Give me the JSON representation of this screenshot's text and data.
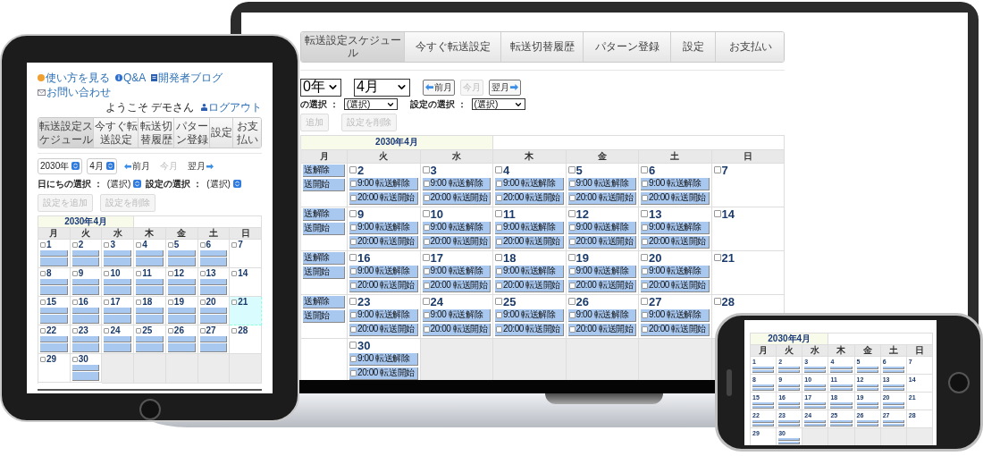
{
  "laptop": {
    "tabs": [
      {
        "label": "転送設定スケジュール",
        "selected": true
      },
      {
        "label": "今すぐ転送設定",
        "selected": false
      },
      {
        "label": "転送切替履歴",
        "selected": false
      },
      {
        "label": "パターン登録",
        "selected": false
      },
      {
        "label": "設定",
        "selected": false
      },
      {
        "label": "お支払い",
        "selected": false
      }
    ],
    "year_select": {
      "value": "0年"
    },
    "month_select": {
      "value": "4月"
    },
    "nav_buttons": [
      {
        "kind": "prev",
        "label": "前月",
        "disabled": false
      },
      {
        "kind": "plain",
        "label": "今月",
        "disabled": true
      },
      {
        "kind": "next",
        "label": "翌月",
        "disabled": false
      }
    ],
    "filters": [
      {
        "label": "の選択 ：",
        "value": "(選択)"
      },
      {
        "label": "設定の選択 ：",
        "value": "(選択)"
      }
    ],
    "actions": [
      {
        "label": "追加",
        "disabled": true
      },
      {
        "label": "設定を削除",
        "disabled": true
      }
    ],
    "calendar": {
      "title": "2030年4月",
      "weekdays": [
        "月",
        "火",
        "水",
        "木",
        "金",
        "土",
        "日"
      ],
      "weeks": [
        [
          {
            "kind": "day",
            "events": [
              {
                "kind": "cut",
                "text": "送解除"
              },
              {
                "kind": "cut",
                "text": "送開始"
              }
            ]
          },
          {
            "kind": "day",
            "day": "2",
            "checked": false,
            "events": [
              {
                "kind": "label",
                "text": "9:00 転送解除",
                "checked": false
              },
              {
                "kind": "label",
                "text": "20:00 転送開始",
                "checked": false
              }
            ]
          },
          {
            "kind": "day",
            "day": "3",
            "checked": false,
            "events": [
              {
                "kind": "label",
                "text": "9:00 転送解除",
                "checked": false
              },
              {
                "kind": "label",
                "text": "20:00 転送開始",
                "checked": false
              }
            ]
          },
          {
            "kind": "day",
            "day": "4",
            "checked": false,
            "events": [
              {
                "kind": "label",
                "text": "9:00 転送解除",
                "checked": false
              },
              {
                "kind": "label",
                "text": "20:00 転送開始",
                "checked": false
              }
            ]
          },
          {
            "kind": "day",
            "day": "5",
            "checked": false,
            "events": [
              {
                "kind": "label",
                "text": "9:00 転送解除",
                "checked": false
              },
              {
                "kind": "label",
                "text": "20:00 転送開始",
                "checked": false
              }
            ]
          },
          {
            "kind": "day",
            "day": "6",
            "checked": false,
            "events": [
              {
                "kind": "label",
                "text": "9:00 転送解除",
                "checked": false
              },
              {
                "kind": "label",
                "text": "20:00 転送開始",
                "checked": false
              }
            ]
          },
          {
            "kind": "day",
            "day": "7",
            "checked": false
          }
        ],
        [
          {
            "kind": "day",
            "events": [
              {
                "kind": "cut",
                "text": "送解除"
              },
              {
                "kind": "cut",
                "text": "送開始"
              }
            ]
          },
          {
            "kind": "day",
            "day": "9",
            "checked": false,
            "events": [
              {
                "kind": "label",
                "text": "9:00 転送解除",
                "checked": false
              },
              {
                "kind": "label",
                "text": "20:00 転送開始",
                "checked": false
              }
            ]
          },
          {
            "kind": "day",
            "day": "10",
            "checked": false,
            "events": [
              {
                "kind": "label",
                "text": "9:00 転送解除",
                "checked": false
              },
              {
                "kind": "label",
                "text": "20:00 転送開始",
                "checked": false
              }
            ]
          },
          {
            "kind": "day",
            "day": "11",
            "checked": false,
            "events": [
              {
                "kind": "label",
                "text": "9:00 転送解除",
                "checked": false
              },
              {
                "kind": "label",
                "text": "20:00 転送開始",
                "checked": false
              }
            ]
          },
          {
            "kind": "day",
            "day": "12",
            "checked": false,
            "events": [
              {
                "kind": "label",
                "text": "9:00 転送解除",
                "checked": false
              },
              {
                "kind": "label",
                "text": "20:00 転送開始",
                "checked": false
              }
            ]
          },
          {
            "kind": "day",
            "day": "13",
            "checked": false,
            "events": [
              {
                "kind": "label",
                "text": "9:00 転送解除",
                "checked": false
              },
              {
                "kind": "label",
                "text": "20:00 転送開始",
                "checked": false
              }
            ]
          },
          {
            "kind": "day",
            "day": "14",
            "checked": false
          }
        ],
        [
          {
            "kind": "day",
            "events": [
              {
                "kind": "cut",
                "text": "送解除"
              },
              {
                "kind": "cut",
                "text": "送開始"
              }
            ]
          },
          {
            "kind": "day",
            "day": "16",
            "checked": false,
            "events": [
              {
                "kind": "label",
                "text": "9:00 転送解除",
                "checked": false
              },
              {
                "kind": "label",
                "text": "20:00 転送開始",
                "checked": false
              }
            ]
          },
          {
            "kind": "day",
            "day": "17",
            "checked": false,
            "events": [
              {
                "kind": "label",
                "text": "9:00 転送解除",
                "checked": false
              },
              {
                "kind": "label",
                "text": "20:00 転送開始",
                "checked": false
              }
            ]
          },
          {
            "kind": "day",
            "day": "18",
            "checked": false,
            "events": [
              {
                "kind": "label",
                "text": "9:00 転送解除",
                "checked": false
              },
              {
                "kind": "label",
                "text": "20:00 転送開始",
                "checked": false
              }
            ]
          },
          {
            "kind": "day",
            "day": "19",
            "checked": false,
            "events": [
              {
                "kind": "label",
                "text": "9:00 転送解除",
                "checked": false
              },
              {
                "kind": "label",
                "text": "20:00 転送開始",
                "checked": false
              }
            ]
          },
          {
            "kind": "day",
            "day": "20",
            "checked": false,
            "events": [
              {
                "kind": "label",
                "text": "9:00 転送解除",
                "checked": false
              },
              {
                "kind": "label",
                "text": "20:00 転送開始",
                "checked": false
              }
            ]
          },
          {
            "kind": "day",
            "day": "21",
            "checked": false
          }
        ],
        [
          {
            "kind": "day",
            "events": [
              {
                "kind": "cut",
                "text": "送解除"
              },
              {
                "kind": "cut",
                "text": "送開始"
              }
            ]
          },
          {
            "kind": "day",
            "day": "23",
            "checked": false,
            "events": [
              {
                "kind": "label",
                "text": "9:00 転送解除",
                "checked": false
              },
              {
                "kind": "label",
                "text": "20:00 転送開始",
                "checked": false
              }
            ]
          },
          {
            "kind": "day",
            "day": "24",
            "checked": false,
            "events": [
              {
                "kind": "label",
                "text": "9:00 転送解除",
                "checked": false
              },
              {
                "kind": "label",
                "text": "20:00 転送開始",
                "checked": false
              }
            ]
          },
          {
            "kind": "day",
            "day": "25",
            "checked": false,
            "events": [
              {
                "kind": "label",
                "text": "9:00 転送解除",
                "checked": false
              },
              {
                "kind": "label",
                "text": "20:00 転送開始",
                "checked": false
              }
            ]
          },
          {
            "kind": "day",
            "day": "26",
            "checked": false,
            "events": [
              {
                "kind": "label",
                "text": "9:00 転送解除",
                "checked": false
              },
              {
                "kind": "label",
                "text": "20:00 転送開始",
                "checked": false
              }
            ]
          },
          {
            "kind": "day",
            "day": "27",
            "checked": false,
            "events": [
              {
                "kind": "label",
                "text": "9:00 転送解除",
                "checked": false
              },
              {
                "kind": "label",
                "text": "20:00 転送開始",
                "checked": false
              }
            ]
          },
          {
            "kind": "day",
            "day": "28",
            "checked": false
          }
        ],
        [
          {
            "kind": "day"
          },
          {
            "kind": "day",
            "day": "30",
            "checked": false,
            "events": [
              {
                "kind": "label",
                "text": "9:00 転送解除",
                "checked": false
              },
              {
                "kind": "label",
                "text": "20:00 転送開始",
                "checked": false
              }
            ]
          },
          {
            "kind": "blank"
          },
          {
            "kind": "blank"
          },
          {
            "kind": "blank"
          },
          {
            "kind": "blank"
          },
          {
            "kind": "blank"
          }
        ]
      ]
    }
  },
  "tablet": {
    "links": [
      {
        "kind": "help",
        "label": "使い方を見る"
      },
      {
        "kind": "faq",
        "label": "Q&A"
      },
      {
        "kind": "blog",
        "label": "開発者ブログ"
      },
      {
        "kind": "contact",
        "label": "お問い合わせ"
      }
    ],
    "welcome": "ようこそ デモさん",
    "logout": "ログアウト",
    "tabs": [
      {
        "label": "転送設定スケジュール",
        "selected": true
      },
      {
        "label": "今すぐ転送設定",
        "selected": false
      },
      {
        "label": "転送切替履歴",
        "selected": false
      },
      {
        "label": "パターン登録",
        "selected": false
      },
      {
        "label": "設定",
        "selected": false
      },
      {
        "label": "お支払い",
        "selected": false
      }
    ],
    "year_select": {
      "value": "2030年"
    },
    "month_select": {
      "value": "4月"
    },
    "nav_buttons": [
      {
        "kind": "prev",
        "label": "前月",
        "disabled": false
      },
      {
        "kind": "plain",
        "label": "今月",
        "disabled": true
      },
      {
        "kind": "next",
        "label": "翌月",
        "disabled": false
      }
    ],
    "filters": [
      {
        "label": "日にちの選択 ：",
        "value": "(選択)"
      },
      {
        "label": "設定の選択 ：",
        "value": "(選択)"
      }
    ],
    "actions": [
      {
        "label": "設定を追加",
        "disabled": true
      },
      {
        "label": "設定を削除",
        "disabled": true
      }
    ],
    "calendar": {
      "title": "2030年4月",
      "weekdays": [
        "月",
        "火",
        "水",
        "木",
        "金",
        "土",
        "日"
      ],
      "weeks": [
        [
          {
            "kind": "day",
            "day": "1",
            "checked": false,
            "today": false,
            "events": [
              {
                "kind": "blurred"
              },
              {
                "kind": "blurred"
              }
            ]
          },
          {
            "kind": "day",
            "day": "2",
            "checked": false,
            "today": false,
            "events": [
              {
                "kind": "blurred"
              },
              {
                "kind": "blurred"
              }
            ]
          },
          {
            "kind": "day",
            "day": "3",
            "checked": false,
            "today": false,
            "events": [
              {
                "kind": "blurred"
              },
              {
                "kind": "blurred"
              }
            ]
          },
          {
            "kind": "day",
            "day": "4",
            "checked": false,
            "today": false,
            "events": [
              {
                "kind": "blurred"
              },
              {
                "kind": "blurred"
              }
            ]
          },
          {
            "kind": "day",
            "day": "5",
            "checked": false,
            "today": false,
            "events": [
              {
                "kind": "blurred"
              },
              {
                "kind": "blurred"
              }
            ]
          },
          {
            "kind": "day",
            "day": "6",
            "checked": false,
            "today": false,
            "events": [
              {
                "kind": "blurred"
              },
              {
                "kind": "blurred"
              }
            ]
          },
          {
            "kind": "day",
            "day": "7",
            "checked": false,
            "today": false
          }
        ],
        [
          {
            "kind": "day",
            "day": "8",
            "checked": false,
            "today": false,
            "events": [
              {
                "kind": "blurred"
              },
              {
                "kind": "blurred"
              }
            ]
          },
          {
            "kind": "day",
            "day": "9",
            "checked": false,
            "today": false,
            "events": [
              {
                "kind": "blurred"
              },
              {
                "kind": "blurred"
              }
            ]
          },
          {
            "kind": "day",
            "day": "10",
            "checked": false,
            "today": false,
            "events": [
              {
                "kind": "blurred"
              },
              {
                "kind": "blurred"
              }
            ]
          },
          {
            "kind": "day",
            "day": "11",
            "checked": false,
            "today": false,
            "events": [
              {
                "kind": "blurred"
              },
              {
                "kind": "blurred"
              }
            ]
          },
          {
            "kind": "day",
            "day": "12",
            "checked": false,
            "today": false,
            "events": [
              {
                "kind": "blurred"
              },
              {
                "kind": "blurred"
              }
            ]
          },
          {
            "kind": "day",
            "day": "13",
            "checked": false,
            "today": false,
            "events": [
              {
                "kind": "blurred"
              },
              {
                "kind": "blurred"
              }
            ]
          },
          {
            "kind": "day",
            "day": "14",
            "checked": false,
            "today": false
          }
        ],
        [
          {
            "kind": "day",
            "day": "15",
            "checked": false,
            "today": false,
            "events": [
              {
                "kind": "blurred"
              },
              {
                "kind": "blurred"
              }
            ]
          },
          {
            "kind": "day",
            "day": "16",
            "checked": false,
            "today": false,
            "events": [
              {
                "kind": "blurred"
              },
              {
                "kind": "blurred"
              }
            ]
          },
          {
            "kind": "day",
            "day": "17",
            "checked": false,
            "today": false,
            "events": [
              {
                "kind": "blurred"
              },
              {
                "kind": "blurred"
              }
            ]
          },
          {
            "kind": "day",
            "day": "18",
            "checked": false,
            "today": false,
            "events": [
              {
                "kind": "blurred"
              },
              {
                "kind": "blurred"
              }
            ]
          },
          {
            "kind": "day",
            "day": "19",
            "checked": false,
            "today": false,
            "events": [
              {
                "kind": "blurred"
              },
              {
                "kind": "blurred"
              }
            ]
          },
          {
            "kind": "day",
            "day": "20",
            "checked": false,
            "today": false,
            "events": [
              {
                "kind": "blurred"
              },
              {
                "kind": "blurred"
              }
            ]
          },
          {
            "kind": "day",
            "day": "21",
            "checked": false,
            "today": true
          }
        ],
        [
          {
            "kind": "day",
            "day": "22",
            "checked": false,
            "today": false,
            "events": [
              {
                "kind": "blurred"
              },
              {
                "kind": "blurred"
              }
            ]
          },
          {
            "kind": "day",
            "day": "23",
            "checked": false,
            "today": false,
            "events": [
              {
                "kind": "blurred"
              },
              {
                "kind": "blurred"
              }
            ]
          },
          {
            "kind": "day",
            "day": "24",
            "checked": false,
            "today": false,
            "events": [
              {
                "kind": "blurred"
              },
              {
                "kind": "blurred"
              }
            ]
          },
          {
            "kind": "day",
            "day": "25",
            "checked": false,
            "today": false,
            "events": [
              {
                "kind": "blurred"
              },
              {
                "kind": "blurred"
              }
            ]
          },
          {
            "kind": "day",
            "day": "26",
            "checked": false,
            "today": false,
            "events": [
              {
                "kind": "blurred"
              },
              {
                "kind": "blurred"
              }
            ]
          },
          {
            "kind": "day",
            "day": "27",
            "checked": false,
            "today": false,
            "events": [
              {
                "kind": "blurred"
              },
              {
                "kind": "blurred"
              }
            ]
          },
          {
            "kind": "day",
            "day": "28",
            "checked": false,
            "today": false
          }
        ],
        [
          {
            "kind": "day",
            "day": "29",
            "checked": false,
            "today": false
          },
          {
            "kind": "day",
            "day": "30",
            "checked": false,
            "today": false,
            "events": [
              {
                "kind": "blurred"
              },
              {
                "kind": "blurred"
              }
            ]
          },
          {
            "kind": "blank"
          },
          {
            "kind": "blank"
          },
          {
            "kind": "blank"
          },
          {
            "kind": "blank"
          },
          {
            "kind": "blank"
          }
        ]
      ]
    }
  },
  "phone": {
    "calendar": {
      "title": "2030年4月",
      "weekdays": [
        "月",
        "火",
        "水",
        "木",
        "金",
        "土",
        "日"
      ],
      "weeks": [
        [
          {
            "kind": "day",
            "day": "1",
            "events": [
              {
                "kind": "blurred"
              },
              {
                "kind": "blurred"
              }
            ]
          },
          {
            "kind": "day",
            "day": "2",
            "events": [
              {
                "kind": "blurred"
              },
              {
                "kind": "blurred"
              }
            ]
          },
          {
            "kind": "day",
            "day": "3",
            "events": [
              {
                "kind": "blurred"
              },
              {
                "kind": "blurred"
              }
            ]
          },
          {
            "kind": "day",
            "day": "4",
            "events": [
              {
                "kind": "blurred"
              },
              {
                "kind": "blurred"
              }
            ]
          },
          {
            "kind": "day",
            "day": "5",
            "events": [
              {
                "kind": "blurred"
              },
              {
                "kind": "blurred"
              }
            ]
          },
          {
            "kind": "day",
            "day": "6",
            "events": [
              {
                "kind": "blurred"
              },
              {
                "kind": "blurred"
              }
            ]
          },
          {
            "kind": "day",
            "day": "7"
          }
        ],
        [
          {
            "kind": "day",
            "day": "8",
            "events": [
              {
                "kind": "blurred"
              },
              {
                "kind": "blurred"
              }
            ]
          },
          {
            "kind": "day",
            "day": "9",
            "events": [
              {
                "kind": "blurred"
              },
              {
                "kind": "blurred"
              }
            ]
          },
          {
            "kind": "day",
            "day": "10",
            "events": [
              {
                "kind": "blurred"
              },
              {
                "kind": "blurred"
              }
            ]
          },
          {
            "kind": "day",
            "day": "11",
            "events": [
              {
                "kind": "blurred"
              },
              {
                "kind": "blurred"
              }
            ]
          },
          {
            "kind": "day",
            "day": "12",
            "events": [
              {
                "kind": "blurred"
              },
              {
                "kind": "blurred"
              }
            ]
          },
          {
            "kind": "day",
            "day": "13",
            "events": [
              {
                "kind": "blurred"
              },
              {
                "kind": "blurred"
              }
            ]
          },
          {
            "kind": "day",
            "day": "14"
          }
        ],
        [
          {
            "kind": "day",
            "day": "15",
            "events": [
              {
                "kind": "blurred"
              },
              {
                "kind": "blurred"
              }
            ]
          },
          {
            "kind": "day",
            "day": "16",
            "events": [
              {
                "kind": "blurred"
              },
              {
                "kind": "blurred"
              }
            ]
          },
          {
            "kind": "day",
            "day": "17",
            "events": [
              {
                "kind": "blurred"
              },
              {
                "kind": "blurred"
              }
            ]
          },
          {
            "kind": "day",
            "day": "18",
            "events": [
              {
                "kind": "blurred"
              },
              {
                "kind": "blurred"
              }
            ]
          },
          {
            "kind": "day",
            "day": "19",
            "events": [
              {
                "kind": "blurred"
              },
              {
                "kind": "blurred"
              }
            ]
          },
          {
            "kind": "day",
            "day": "20",
            "events": [
              {
                "kind": "blurred"
              },
              {
                "kind": "blurred"
              }
            ]
          },
          {
            "kind": "day",
            "day": "21"
          }
        ],
        [
          {
            "kind": "day",
            "day": "22",
            "events": [
              {
                "kind": "blurred"
              },
              {
                "kind": "blurred"
              }
            ]
          },
          {
            "kind": "day",
            "day": "23",
            "events": [
              {
                "kind": "blurred"
              },
              {
                "kind": "blurred"
              }
            ]
          },
          {
            "kind": "day",
            "day": "24",
            "events": [
              {
                "kind": "blurred"
              },
              {
                "kind": "blurred"
              }
            ]
          },
          {
            "kind": "day",
            "day": "25",
            "events": [
              {
                "kind": "blurred"
              },
              {
                "kind": "blurred"
              }
            ]
          },
          {
            "kind": "day",
            "day": "26",
            "events": [
              {
                "kind": "blurred"
              },
              {
                "kind": "blurred"
              }
            ]
          },
          {
            "kind": "day",
            "day": "27",
            "events": [
              {
                "kind": "blurred"
              },
              {
                "kind": "blurred"
              }
            ]
          },
          {
            "kind": "day",
            "day": "28"
          }
        ],
        [
          {
            "kind": "day",
            "day": "29"
          },
          {
            "kind": "day",
            "day": "30",
            "events": [
              {
                "kind": "blurred"
              },
              {
                "kind": "blurred"
              }
            ]
          },
          {
            "kind": "blank"
          },
          {
            "kind": "blank"
          },
          {
            "kind": "blank"
          },
          {
            "kind": "blank"
          },
          {
            "kind": "blank"
          }
        ]
      ]
    }
  }
}
